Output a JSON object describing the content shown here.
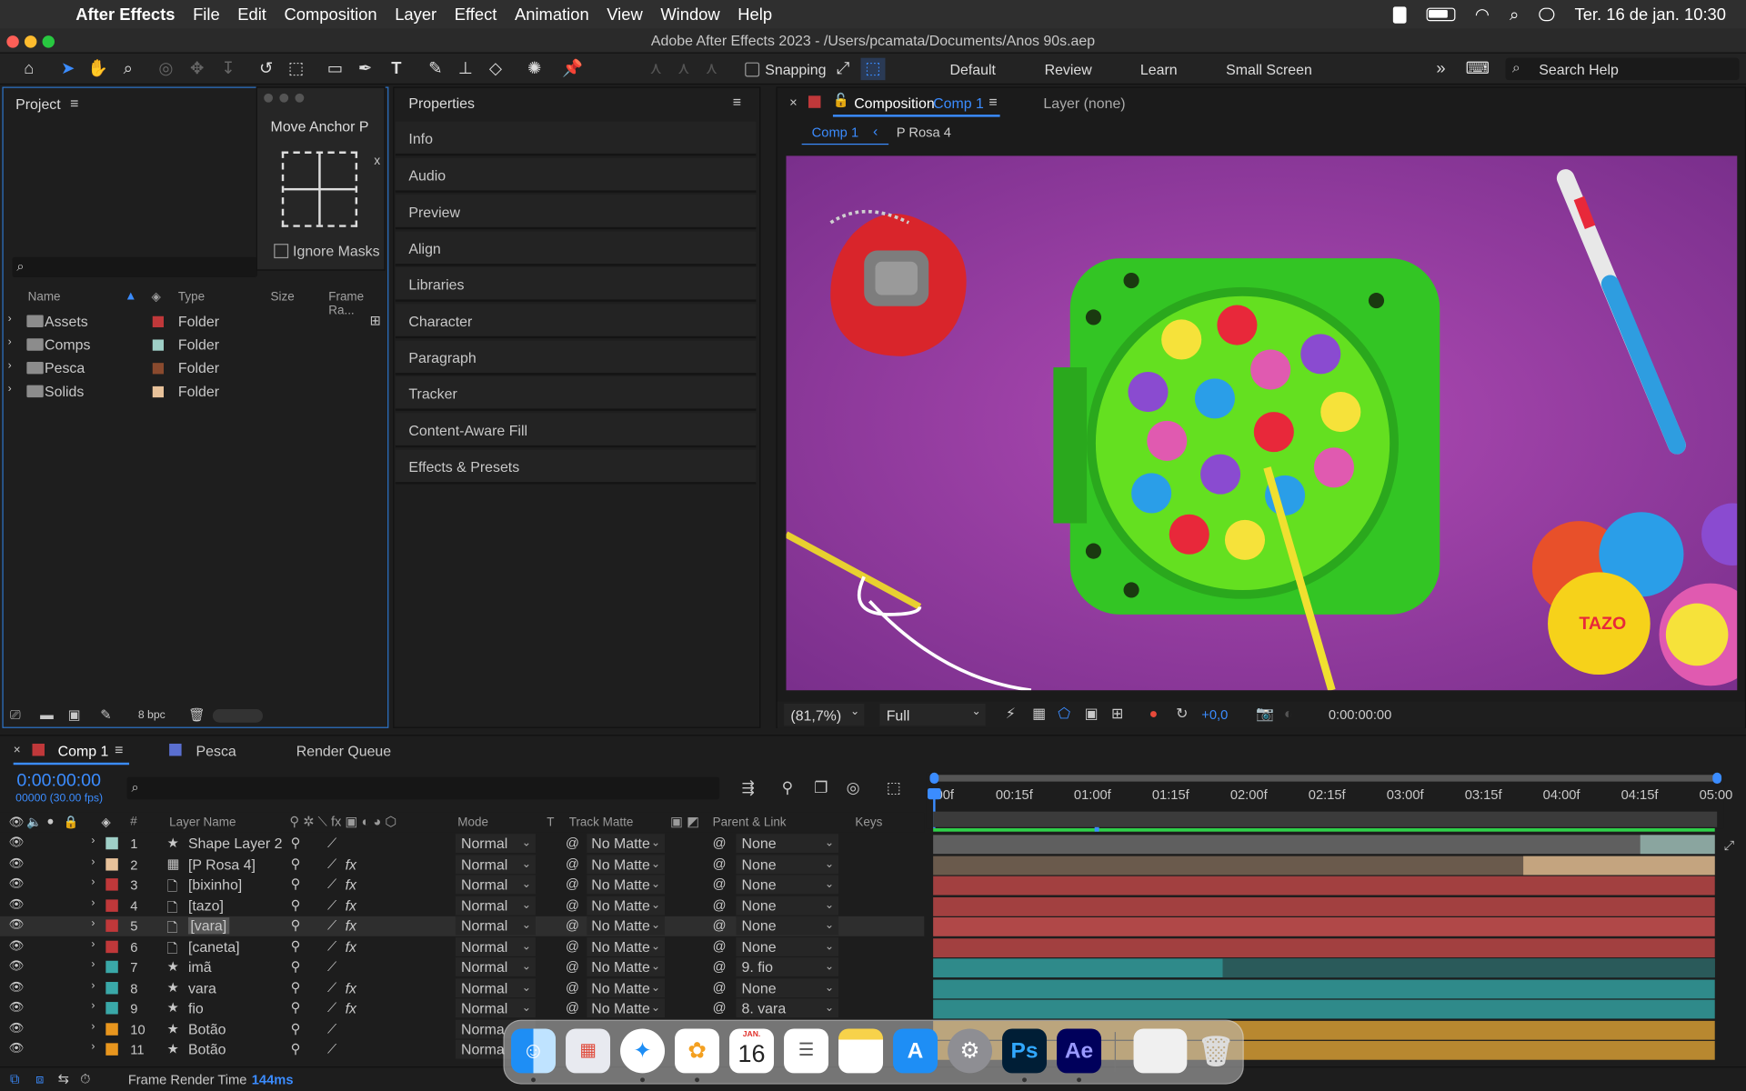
{
  "menubar": {
    "app_name": "After Effects",
    "items": [
      "File",
      "Edit",
      "Composition",
      "Layer",
      "Effect",
      "Animation",
      "View",
      "Window",
      "Help"
    ],
    "datetime": "Ter. 16 de jan.  10:30"
  },
  "window": {
    "title": "Adobe After Effects 2023 - /Users/pcamata/Documents/Anos 90s.aep"
  },
  "toolbar": {
    "snapping_label": "Snapping",
    "workspaces": [
      "Default",
      "Review",
      "Learn",
      "Small Screen"
    ],
    "search_placeholder": "Search Help"
  },
  "project": {
    "title": "Project",
    "columns": {
      "name": "Name",
      "type": "Type",
      "size": "Size",
      "frame_rate": "Frame Ra..."
    },
    "rows": [
      {
        "name": "Assets",
        "type": "Folder",
        "color": "#c0383a"
      },
      {
        "name": "Comps",
        "type": "Folder",
        "color": "#9fcfc7"
      },
      {
        "name": "Pesca",
        "type": "Folder",
        "color": "#8a4a2e"
      },
      {
        "name": "Solids",
        "type": "Folder",
        "color": "#e8c29a"
      }
    ],
    "bpc": "8 bpc"
  },
  "anchor_panel": {
    "title": "Move Anchor P",
    "ignore_masks": "Ignore Masks"
  },
  "properties": {
    "title": "Properties",
    "items": [
      "Info",
      "Audio",
      "Preview",
      "Align",
      "Libraries",
      "Character",
      "Paragraph",
      "Tracker",
      "Content-Aware Fill",
      "Effects & Presets"
    ]
  },
  "composition": {
    "tab_prefix": "Composition",
    "tab_name": "Comp 1",
    "layer_tab": "Layer (none)",
    "breadcrumb_active": "Comp 1",
    "breadcrumb_next": "P Rosa 4",
    "zoom": "(81,7%)",
    "resolution": "Full",
    "exposure": "+0,0",
    "timecode": "0:00:00:00"
  },
  "timeline": {
    "tabs": [
      "Comp 1",
      "Pesca",
      "Render Queue"
    ],
    "tab_colors": [
      "#c0383a",
      "#5a6fd0"
    ],
    "current_time": "0:00:00:00",
    "frame_info": "00000 (30.00 fps)",
    "headers": {
      "layer_name": "Layer Name",
      "mode": "Mode",
      "t": "T",
      "track_matte": "Track Matte",
      "parent": "Parent & Link",
      "keys": "Keys"
    },
    "ruler": [
      "00f",
      "00:15f",
      "01:00f",
      "01:15f",
      "02:00f",
      "02:15f",
      "03:00f",
      "03:15f",
      "04:00f",
      "04:15f",
      "05:00"
    ],
    "layers": [
      {
        "num": "1",
        "name": "Shape Layer 2",
        "mode": "Normal",
        "matte": "No Matte",
        "parent": "None",
        "color": "#9fcfc7",
        "kind": "star",
        "fx": false
      },
      {
        "num": "2",
        "name": "[P Rosa 4]",
        "mode": "Normal",
        "matte": "No Matte",
        "parent": "None",
        "color": "#e8c29a",
        "kind": "comp",
        "fx": true
      },
      {
        "num": "3",
        "name": "[bixinho]",
        "mode": "Normal",
        "matte": "No Matte",
        "parent": "None",
        "color": "#c0383a",
        "kind": "file",
        "fx": true
      },
      {
        "num": "4",
        "name": "[tazo]",
        "mode": "Normal",
        "matte": "No Matte",
        "parent": "None",
        "color": "#c0383a",
        "kind": "file",
        "fx": true
      },
      {
        "num": "5",
        "name": "[vara]",
        "mode": "Normal",
        "matte": "No Matte",
        "parent": "None",
        "color": "#c0383a",
        "kind": "file",
        "fx": true,
        "selected": true
      },
      {
        "num": "6",
        "name": "[caneta]",
        "mode": "Normal",
        "matte": "No Matte",
        "parent": "None",
        "color": "#c0383a",
        "kind": "file",
        "fx": true
      },
      {
        "num": "7",
        "name": "imã",
        "mode": "Normal",
        "matte": "No Matte",
        "parent": "9. fio",
        "color": "#3aa8a8",
        "kind": "star",
        "fx": false
      },
      {
        "num": "8",
        "name": "vara",
        "mode": "Normal",
        "matte": "No Matte",
        "parent": "None",
        "color": "#3aa8a8",
        "kind": "star",
        "fx": true
      },
      {
        "num": "9",
        "name": "fio",
        "mode": "Normal",
        "matte": "No Matte",
        "parent": "8. vara",
        "color": "#3aa8a8",
        "kind": "star",
        "fx": true
      },
      {
        "num": "10",
        "name": "Botão",
        "mode": "Norma",
        "matte": "",
        "parent": "",
        "color": "#e8961e",
        "kind": "star",
        "fx": false
      },
      {
        "num": "11",
        "name": "Botão",
        "mode": "Norma",
        "matte": "",
        "parent": "",
        "color": "#e8961e",
        "kind": "star",
        "fx": false
      }
    ],
    "bars": [
      {
        "color": "#5f5f5f",
        "end_color": "#8aa59f",
        "start": 0.0,
        "split": 0.905
      },
      {
        "color": "#6a5a4c",
        "end_color": "#c4a47f",
        "start": 0.0,
        "split": 0.755
      },
      {
        "color": "#a24040",
        "start": 0.0
      },
      {
        "color": "#a24040",
        "start": 0.0
      },
      {
        "color": "#b04848",
        "start": 0.0
      },
      {
        "color": "#a24040",
        "start": 0.0
      },
      {
        "color": "#2f8a8a",
        "end_color": "#2a5a5a",
        "start": 0.0,
        "split": 0.37
      },
      {
        "color": "#2f8a8a",
        "start": 0.0
      },
      {
        "color": "#2f8a8a",
        "start": 0.0
      },
      {
        "color": "#b88830",
        "start": 0.0
      },
      {
        "color": "#b88830",
        "start": 0.0
      }
    ],
    "frame_render_label": "Frame Render Time",
    "frame_render_value": "144ms"
  },
  "dock": {
    "calendar_month": "JAN.",
    "calendar_day": "16",
    "ps_label": "Ps",
    "ae_label": "Ae"
  },
  "viewer_tazo_text": "TAZO"
}
